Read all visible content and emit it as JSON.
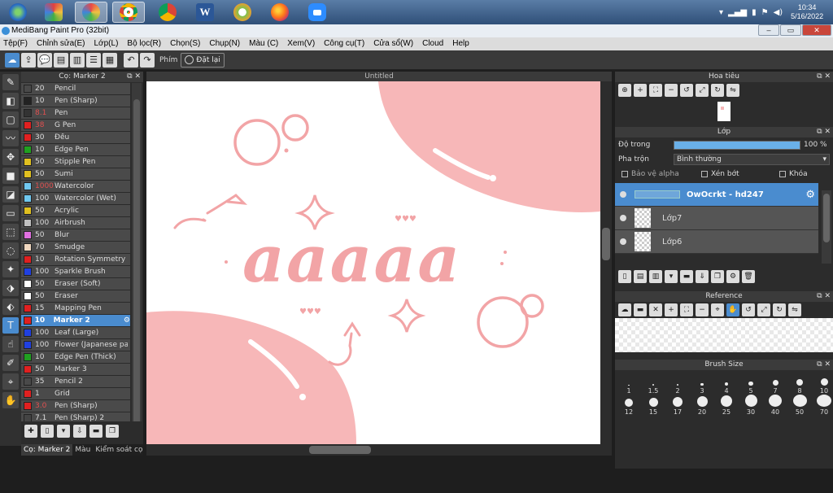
{
  "taskbar": {
    "clock_time": "10:34",
    "clock_date": "5/16/2022",
    "word_label": "W"
  },
  "titlebar": {
    "title": "MediBang Paint Pro (32bit)"
  },
  "menu": [
    "Tệp(F)",
    "Chỉnh sửa(E)",
    "Lớp(L)",
    "Bộ lọc(R)",
    "Chọn(S)",
    "Chụp(N)",
    "Màu (C)",
    "Xem(V)",
    "Công cụ(T)",
    "Cửa sổ(W)",
    "Cloud",
    "Help"
  ],
  "toolbar": {
    "shortcut_label": "Phím",
    "reset_label": "Đặt lại"
  },
  "brush_panel": {
    "title": "Cọ: Marker 2",
    "brushes": [
      {
        "size": "20",
        "name": "Pencil",
        "color": "#4a4a4a",
        "red": false
      },
      {
        "size": "10",
        "name": "Pen (Sharp)",
        "color": "#222222",
        "red": false
      },
      {
        "size": "8.1",
        "name": "Pen",
        "color": "#333333",
        "red": true
      },
      {
        "size": "38",
        "name": "G Pen",
        "color": "#e02020",
        "red": true
      },
      {
        "size": "30",
        "name": "Đều",
        "color": "#e02020",
        "red": false
      },
      {
        "size": "10",
        "name": "Edge Pen",
        "color": "#20a020",
        "red": false
      },
      {
        "size": "50",
        "name": "Stipple Pen",
        "color": "#e0c020",
        "red": false
      },
      {
        "size": "50",
        "name": "Sumi",
        "color": "#e0c020",
        "red": false
      },
      {
        "size": "1000",
        "name": "Watercolor",
        "color": "#70c8f0",
        "red": true
      },
      {
        "size": "100",
        "name": "Watercolor (Wet)",
        "color": "#70c8f0",
        "red": false
      },
      {
        "size": "50",
        "name": "Acrylic",
        "color": "#e0c020",
        "red": false
      },
      {
        "size": "100",
        "name": "Airbrush",
        "color": "#c0c0c0",
        "red": false
      },
      {
        "size": "50",
        "name": "Blur",
        "color": "#e070e0",
        "red": false
      },
      {
        "size": "70",
        "name": "Smudge",
        "color": "#f0d8c0",
        "red": false
      },
      {
        "size": "10",
        "name": "Rotation Symmetry Pe",
        "color": "#e02020",
        "red": false
      },
      {
        "size": "100",
        "name": "Sparkle Brush",
        "color": "#2040e0",
        "red": false
      },
      {
        "size": "50",
        "name": "Eraser (Soft)",
        "color": "#ffffff",
        "red": false
      },
      {
        "size": "50",
        "name": "Eraser",
        "color": "#ffffff",
        "red": false
      },
      {
        "size": "15",
        "name": "Mapping Pen",
        "color": "#e02020",
        "red": false
      },
      {
        "size": "10",
        "name": "Marker 2",
        "color": "#e02020",
        "red": false
      },
      {
        "size": "100",
        "name": "Leaf (Large)",
        "color": "#2040e0",
        "red": false
      },
      {
        "size": "100",
        "name": "Flower (Japanese patt",
        "color": "#2040e0",
        "red": false
      },
      {
        "size": "10",
        "name": "Edge Pen (Thick)",
        "color": "#20a020",
        "red": false
      },
      {
        "size": "50",
        "name": "Marker 3",
        "color": "#e02020",
        "red": false
      },
      {
        "size": "35",
        "name": "Pencil 2",
        "color": "#4a4a4a",
        "red": false
      },
      {
        "size": "1",
        "name": "Grid",
        "color": "#e02020",
        "red": false
      },
      {
        "size": "3.0",
        "name": "Pen (Sharp)",
        "color": "#e02020",
        "red": true
      },
      {
        "size": "7.1",
        "name": "Pen (Sharp) 2",
        "color": "#444444",
        "red": false
      }
    ],
    "selected_index": 19,
    "tabs": [
      "Cọ: Marker 2",
      "Màu",
      "Kiểm soát cọ"
    ]
  },
  "document": {
    "tab_title": "Untitled",
    "canvas_text": "aaaaa"
  },
  "navigator": {
    "title": "Hoa tiêu"
  },
  "layers": {
    "title": "Lớp",
    "opacity_label": "Độ trong",
    "opacity_value": "100 %",
    "opacity": 1.0,
    "blend_label": "Pha trộn",
    "blend_value": "Bình thường",
    "protect_alpha": "Bảo vệ alpha",
    "clipping": "Xén bớt",
    "lock": "Khóa",
    "items": [
      {
        "name": "OwOcrkt - hd247",
        "selected": true
      },
      {
        "name": "Lớp7",
        "selected": false
      },
      {
        "name": "Lớp6",
        "selected": false
      }
    ]
  },
  "reference": {
    "title": "Reference"
  },
  "brush_size": {
    "title": "Brush Size",
    "sizes": [
      "1",
      "1.5",
      "2",
      "3",
      "4",
      "5",
      "7",
      "8",
      "10",
      "12",
      "15",
      "17",
      "20",
      "25",
      "30",
      "40",
      "50",
      "70"
    ]
  },
  "colors": {
    "accent": "#4a8ccf",
    "canvas_pink": "#f7b7b8",
    "lettering": "#f2a4a6"
  }
}
